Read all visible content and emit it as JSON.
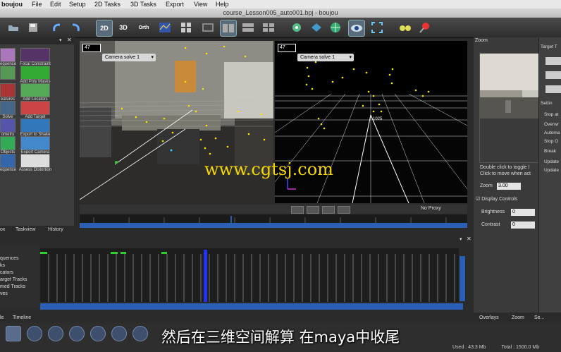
{
  "menubar": {
    "app": "boujou",
    "items": [
      "File",
      "Edit",
      "Setup",
      "2D Tasks",
      "3D Tasks",
      "Export",
      "View",
      "Help"
    ]
  },
  "window_title": "course_Lesson005_auto001.bpj - boujou",
  "toolbar": {
    "btn_2d": "2D",
    "btn_3d": "3D",
    "btn_orth": "Orth"
  },
  "toolbox": {
    "items": [
      "equence",
      "Focal Constraint",
      "",
      "Add Poly Masks",
      "eatures",
      "Add Locators",
      "Solve",
      "Add Target Tracks",
      "ometry",
      "Export to Shake",
      "Objects",
      "Export Camera",
      "equence",
      "Assess Distortion"
    ],
    "tabs": [
      "ox",
      "Taskview",
      "History"
    ]
  },
  "viewport_left": {
    "frame": "47",
    "camera": "Camera solve 1"
  },
  "viewport_right": {
    "frame": "47",
    "camera": "Camera solve 1",
    "label_1025": "1025"
  },
  "viewport_footer": {
    "proxy": "No Proxy"
  },
  "watermark": "www.cgtsj.com",
  "zoom": {
    "title": "Zoom",
    "hint1": "Double click to toggle l",
    "hint2": "Click to move when act",
    "zoom_label": "Zoom",
    "zoom_value": "3.00",
    "display_controls": "Display Controls",
    "brightness_label": "Brightness",
    "brightness_value": "0",
    "contrast_label": "Contrast",
    "contrast_value": "0"
  },
  "target_panel": {
    "title": "Target T",
    "items": [
      "Settin",
      "Stop at",
      "Overwr",
      "Automa",
      "Stop O",
      "Break",
      "Update",
      "Update"
    ]
  },
  "tracklist": {
    "items": [
      "quences",
      "ks",
      "cators",
      "arget Tracks",
      "med Tracks",
      "ves"
    ]
  },
  "bottom_tabs": {
    "left": [
      "le",
      "Timeline"
    ],
    "right": [
      "Overlays",
      "Zoom",
      "Se..."
    ]
  },
  "subtitle": "然后在三维空间解算 在maya中收尾",
  "status": {
    "used": "Used : 43.3 Mb",
    "total": "Total : 1500.0 Mb"
  }
}
